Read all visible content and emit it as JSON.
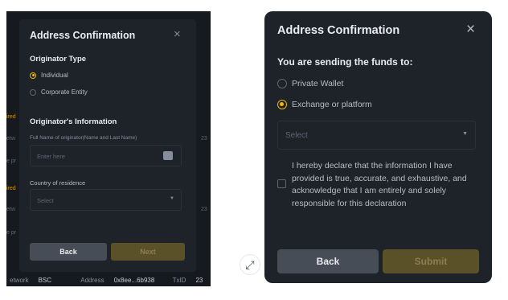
{
  "left": {
    "background_fragments": [
      "ired",
      "etw",
      "e pr",
      "ired",
      "etw",
      "e pr"
    ],
    "background_numbers": [
      "23",
      "23"
    ],
    "footer": {
      "network_label": "etwork",
      "network_value": "BSC",
      "address_label": "Address",
      "address_value": "0x8ee...6b938",
      "txid_label": "TxID",
      "txid_value": "23"
    },
    "modal": {
      "title": "Address Confirmation",
      "close_icon": "×",
      "originator_type_label": "Originator Type",
      "options": [
        {
          "label": "Individual",
          "selected": true
        },
        {
          "label": "Corporate Entity",
          "selected": false
        }
      ],
      "info_heading": "Originator's Information",
      "name_label": "Full Name of originator(Name and Last Name)",
      "name_placeholder": "Enter here",
      "country_label": "Country of residence",
      "country_placeholder": "Select",
      "back_label": "Back",
      "next_label": "Next"
    }
  },
  "expand_icon": "⤢",
  "right": {
    "title": "Address Confirmation",
    "close_icon": "×",
    "subtitle": "You are sending the funds to:",
    "options": [
      {
        "label": "Private Wallet",
        "selected": false
      },
      {
        "label": "Exchange or platform",
        "selected": true
      }
    ],
    "select_placeholder": "Select",
    "declaration": "I hereby declare that the information I have provided is true, accurate, and exhaustive, and acknowledge that I am entirely and solely responsible for this declaration",
    "back_label": "Back",
    "submit_label": "Submit"
  },
  "colors": {
    "accent": "#f0b90b",
    "modal_bg": "#1e2329",
    "page_bg": "#161a1e",
    "disabled_button_bg": "#5b5128"
  }
}
